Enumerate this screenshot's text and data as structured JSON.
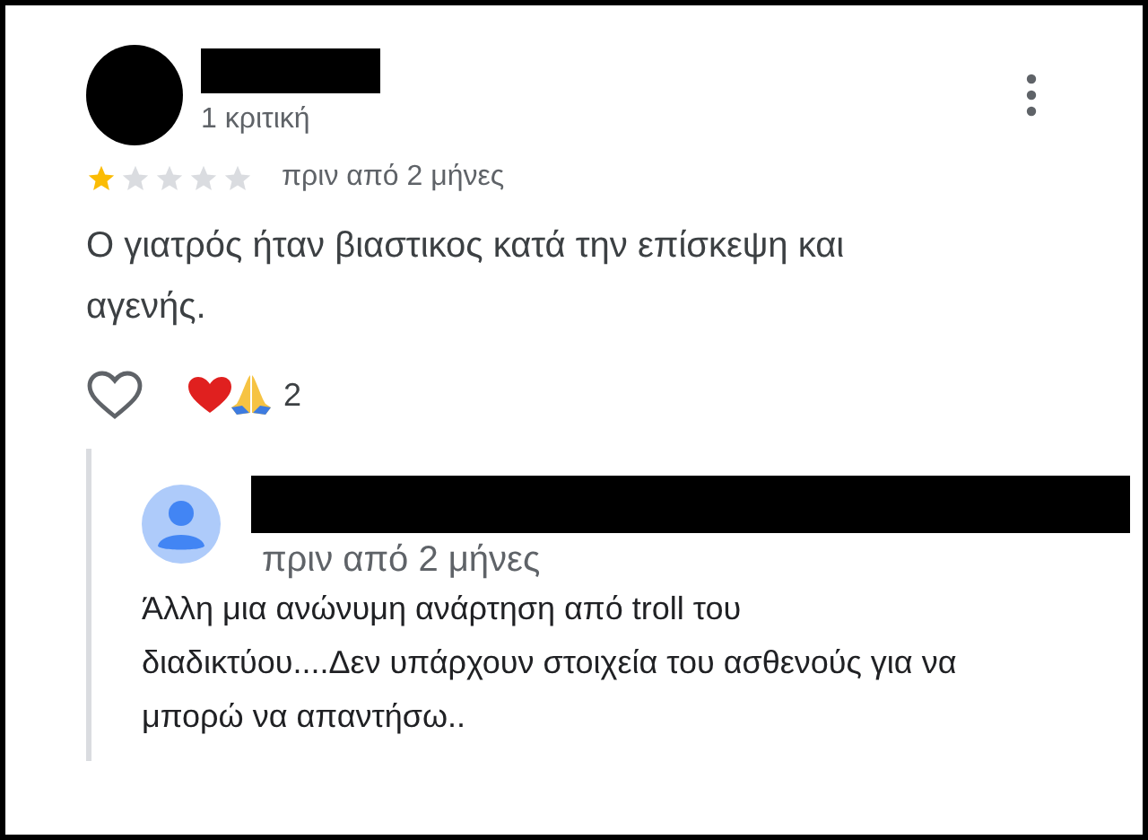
{
  "review": {
    "name_hidden": true,
    "review_count": "1 κριτική",
    "stars": 1,
    "time": "πριν από 2 μήνες",
    "text": "Ο γιατρός ήταν βιαστικος κατά την επίσκεψη και αγενής.",
    "liked": false,
    "reaction_count": "2"
  },
  "reply": {
    "name_hidden": true,
    "time": "πριν από 2 μήνες",
    "text": "Άλλη μια ανώνυμη ανάρτηση από troll του διαδικτύου....Δεν υπάρχουν στοιχεία του ασθενούς για να μπορώ να απαντήσω.."
  }
}
